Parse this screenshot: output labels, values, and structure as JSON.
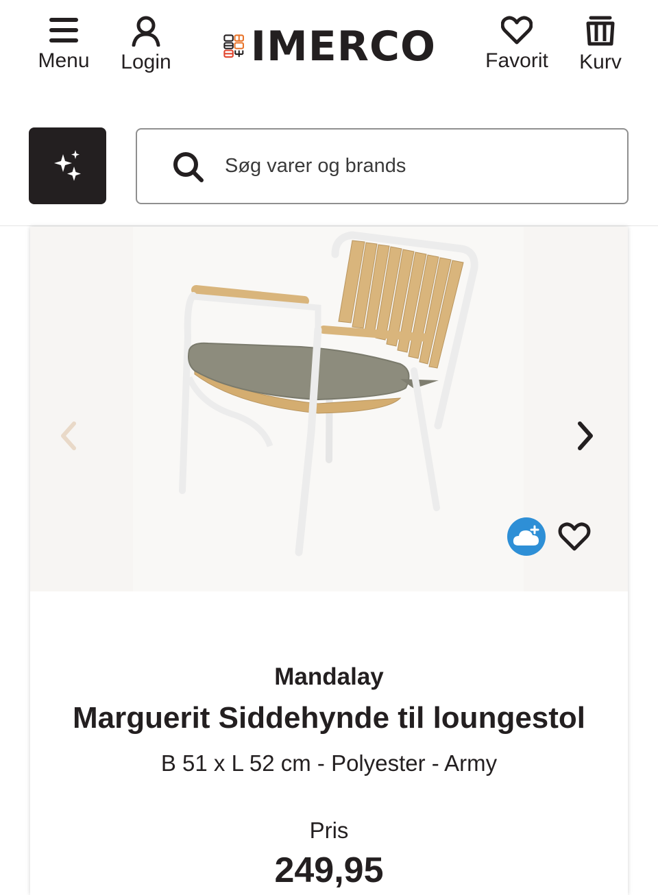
{
  "header": {
    "menu_label": "Menu",
    "login_label": "Login",
    "logo_text": "IMERCO",
    "favorites_label": "Favorit",
    "cart_label": "Kurv"
  },
  "search": {
    "placeholder": "Søg varer og brands",
    "ai_button_icon": "sparkles-icon"
  },
  "icons": {
    "menu": "hamburger-icon",
    "login": "user-icon",
    "favorites": "heart-icon",
    "cart": "basket-icon",
    "search": "search-icon",
    "prev": "chevron-left-icon",
    "next": "chevron-right-icon",
    "cloud": "cloud-plus-icon",
    "wishlist": "heart-outline-icon"
  },
  "product": {
    "brand": "Mandalay",
    "title": "Marguerit Siddehynde til loungestol",
    "subtitle": "B 51 x L 52 cm - Polyester - Army",
    "price_label": "Pris",
    "price": "249,95"
  },
  "colors": {
    "text": "#231f20",
    "ai_button_bg": "#231f20",
    "cloud_button": "#2e8fd6",
    "gallery_bg": "#f7f5f3",
    "cushion": "#8d8c7d",
    "wood": "#d9b57c"
  }
}
